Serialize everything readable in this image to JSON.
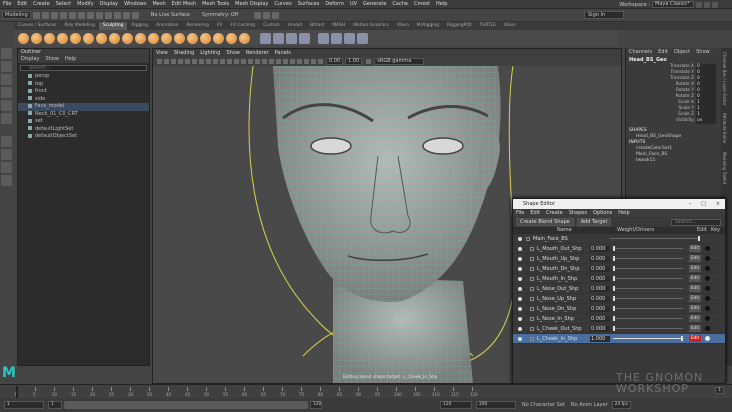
{
  "menubar": {
    "items": [
      "File",
      "Edit",
      "Create",
      "Select",
      "Modify",
      "Display",
      "Windows",
      "Mesh",
      "Edit Mesh",
      "Mesh Tools",
      "Mesh Display",
      "Curves",
      "Surfaces",
      "Deform",
      "UV",
      "Generate",
      "Cache",
      "Cmest",
      "Help"
    ],
    "workspace_label": "Workspace :",
    "workspace_value": "Maya Classic*"
  },
  "statusline": {
    "mode": "Modeling",
    "live_surface": "No Live Surface",
    "symmetry": "Symmetry: Off",
    "signin": "Sign In"
  },
  "shelf": {
    "tabs": [
      "Curves / Surfaces",
      "Poly Modeling",
      "Sculpting",
      "Rigging",
      "Animation",
      "Rendering",
      "FX",
      "FX Caching",
      "Custom",
      "Arnold",
      "Bifrost",
      "MASH",
      "Motion Graphics",
      "XGen",
      "MrRigging",
      "RiggingPQt",
      "TURTLE",
      "XGen"
    ],
    "active_tab": "Sculpting",
    "colors": {
      "sculpt_ball": "#d9862b",
      "tool_square": "#8b8fa8"
    }
  },
  "outliner": {
    "title": "Outliner",
    "menu": [
      "Display",
      "Show",
      "Help"
    ],
    "search_placeholder": "Search...",
    "items": [
      {
        "label": "persp",
        "selected": false
      },
      {
        "label": "top",
        "selected": false
      },
      {
        "label": "front",
        "selected": false
      },
      {
        "label": "side",
        "selected": false
      },
      {
        "label": "Face_model",
        "selected": true
      },
      {
        "label": "Neck_01_C0_CRT",
        "selected": false
      },
      {
        "label": "set",
        "selected": false
      },
      {
        "label": "defaultLightSet",
        "selected": false
      },
      {
        "label": "defaultObjectSet",
        "selected": false
      }
    ]
  },
  "viewport": {
    "menu": [
      "View",
      "Shading",
      "Lighting",
      "Show",
      "Renderer",
      "Panels"
    ],
    "field_a": "0.00",
    "field_b": "1.00",
    "color_space": "sRGB gamma",
    "message": "Editing blend shape target: L_Cheek_In_Shp"
  },
  "channelbox": {
    "tabs": [
      "Channels",
      "Edit",
      "Object",
      "Show"
    ],
    "object": "Head_BS_Geo",
    "attrs": [
      {
        "name": "Translate X",
        "value": "0"
      },
      {
        "name": "Translate Y",
        "value": "0"
      },
      {
        "name": "Translate Z",
        "value": "0"
      },
      {
        "name": "Rotate X",
        "value": "0"
      },
      {
        "name": "Rotate Y",
        "value": "0"
      },
      {
        "name": "Rotate Z",
        "value": "0"
      },
      {
        "name": "Scale X",
        "value": "1"
      },
      {
        "name": "Scale Y",
        "value": "1"
      },
      {
        "name": "Scale Z",
        "value": "1"
      },
      {
        "name": "Visibility",
        "value": "on"
      }
    ],
    "shapes_label": "SHAPES",
    "shape": "Head_BS_GeoShape",
    "inputs_label": "INPUTS",
    "inputs": [
      "createColorSet1",
      "Main_Face_BS",
      "tweak11"
    ],
    "side_tabs": [
      "Channel Box / Layer Editor",
      "Attribute Editor",
      "Modeling Toolkit"
    ]
  },
  "shape_editor": {
    "title": "Shape Editor",
    "menu": [
      "File",
      "Edit",
      "Create",
      "Shapes",
      "Options",
      "Help"
    ],
    "create_btn": "Create Blend Shape",
    "add_btn": "Add Target",
    "search_placeholder": "Search...",
    "col_name": "Name",
    "col_weight": "Weight/Drivers",
    "col_edit": "Edit",
    "col_key": "Key",
    "group": "Main_Face_BS",
    "targets": [
      {
        "name": "L_Mouth_Out_Shp",
        "weight": "0.000",
        "fill": 0.0,
        "edit": "Edit",
        "selected": false
      },
      {
        "name": "L_Mouth_Up_Shp",
        "weight": "0.000",
        "fill": 0.0,
        "edit": "Edit",
        "selected": false
      },
      {
        "name": "L_Mouth_Dn_Shp",
        "weight": "0.000",
        "fill": 0.0,
        "edit": "Edit",
        "selected": false
      },
      {
        "name": "L_Mouth_In_Shp",
        "weight": "0.000",
        "fill": 0.0,
        "edit": "Edit",
        "selected": false
      },
      {
        "name": "L_Nose_Out_Shp",
        "weight": "0.000",
        "fill": 0.0,
        "edit": "Edit",
        "selected": false
      },
      {
        "name": "L_Nose_Up_Shp",
        "weight": "0.000",
        "fill": 0.0,
        "edit": "Edit",
        "selected": false
      },
      {
        "name": "L_Nose_Dn_Shp",
        "weight": "0.000",
        "fill": 0.0,
        "edit": "Edit",
        "selected": false
      },
      {
        "name": "L_Nose_In_Shp",
        "weight": "0.000",
        "fill": 0.0,
        "edit": "Edit",
        "selected": false
      },
      {
        "name": "L_Cheek_Out_Shp",
        "weight": "0.000",
        "fill": 0.0,
        "edit": "Edit",
        "selected": false
      },
      {
        "name": "L_Cheek_In_Shp",
        "weight": "1.000",
        "fill": 1.0,
        "edit": "Edit",
        "selected": true
      }
    ]
  },
  "timeline": {
    "ticks": [
      "1",
      "5",
      "10",
      "15",
      "20",
      "25",
      "30",
      "35",
      "40",
      "45",
      "50",
      "55",
      "60",
      "65",
      "70",
      "75",
      "80",
      "85",
      "90",
      "95",
      "100",
      "105",
      "110",
      "115",
      "120"
    ],
    "current_frame": "1",
    "range_start": "1",
    "range_start_inner": "1",
    "range_end_inner": "120",
    "range_end": "120",
    "anim_end": "200",
    "character_set": "No Character Set",
    "anim_layer": "No Anim Layer",
    "fps": "24 fps"
  },
  "watermark": "THE GNOMON WORKSHOP"
}
